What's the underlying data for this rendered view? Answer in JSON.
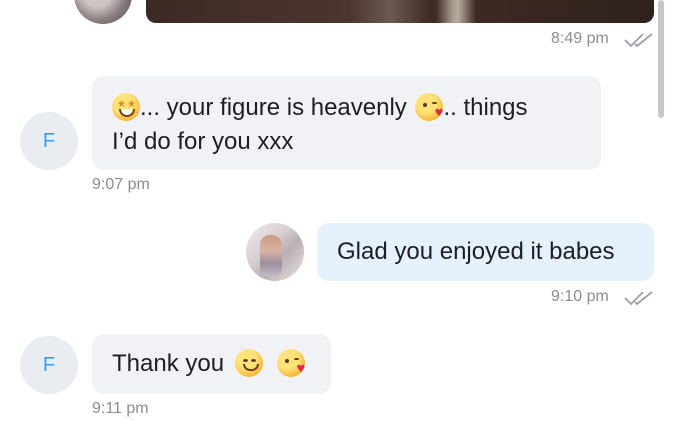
{
  "messages": [
    {
      "time": "8:49 pm"
    },
    {
      "avatar_initial": "F",
      "line1": "... your figure is heavenly",
      "line1_tail": ".. things",
      "line2": "I’d do for you xxx",
      "time": "9:07 pm"
    },
    {
      "text": "Glad you enjoyed it babes",
      "time": "9:10 pm"
    },
    {
      "avatar_initial": "F",
      "text": "Thank you",
      "time": "9:11 pm"
    }
  ],
  "icons": {
    "read_receipt": "double-check-icon",
    "emoji_starstruck": "star-struck-emoji",
    "emoji_kiss": "face-blowing-kiss-emoji",
    "emoji_smile": "smiling-face-emoji"
  },
  "colors": {
    "incoming_bubble": "#f1f2f5",
    "outgoing_bubble": "#e5f1fc",
    "avatar_initial": "#3a9ee6",
    "timestamp": "#8a8d93"
  }
}
